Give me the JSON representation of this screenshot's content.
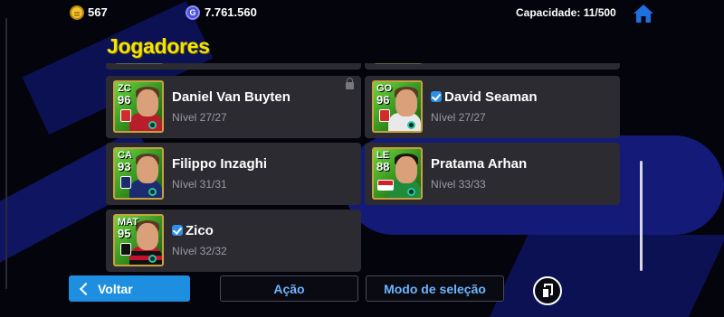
{
  "header": {
    "gp_value": "567",
    "coin_value": "7.761.560",
    "capacity_label": "Capacidade: 11/500",
    "coin_letter": "G"
  },
  "page_title": "Jogadores",
  "players": [
    {
      "name": "Daniel Van Buyten",
      "level": "Nível 27/27",
      "position": "ZC",
      "rating": "96",
      "locked": true,
      "verified": false,
      "icons": [
        "lock-icon"
      ]
    },
    {
      "name": "David Seaman",
      "level": "Nível 27/27",
      "position": "GO",
      "rating": "96",
      "locked": false,
      "verified": true,
      "icons": [
        "check-icon"
      ]
    },
    {
      "name": "Filippo Inzaghi",
      "level": "Nível 31/31",
      "position": "CA",
      "rating": "93",
      "locked": false,
      "verified": false
    },
    {
      "name": "Pratama Arhan",
      "level": "Nível 33/33",
      "position": "LE",
      "rating": "88",
      "locked": false,
      "verified": false
    },
    {
      "name": "Zico",
      "level": "Nível 32/32",
      "position": "MAT",
      "rating": "95",
      "locked": false,
      "verified": true,
      "icons": [
        "check-icon"
      ]
    }
  ],
  "buttons": {
    "back_label": "Voltar",
    "action_label": "Ação",
    "selection_mode_label": "Modo de seleção"
  },
  "colors": {
    "accent": "#1e8fe0",
    "title": "#f5e400",
    "card_bg": "#2b2b31",
    "link_text": "#6db4ff"
  }
}
